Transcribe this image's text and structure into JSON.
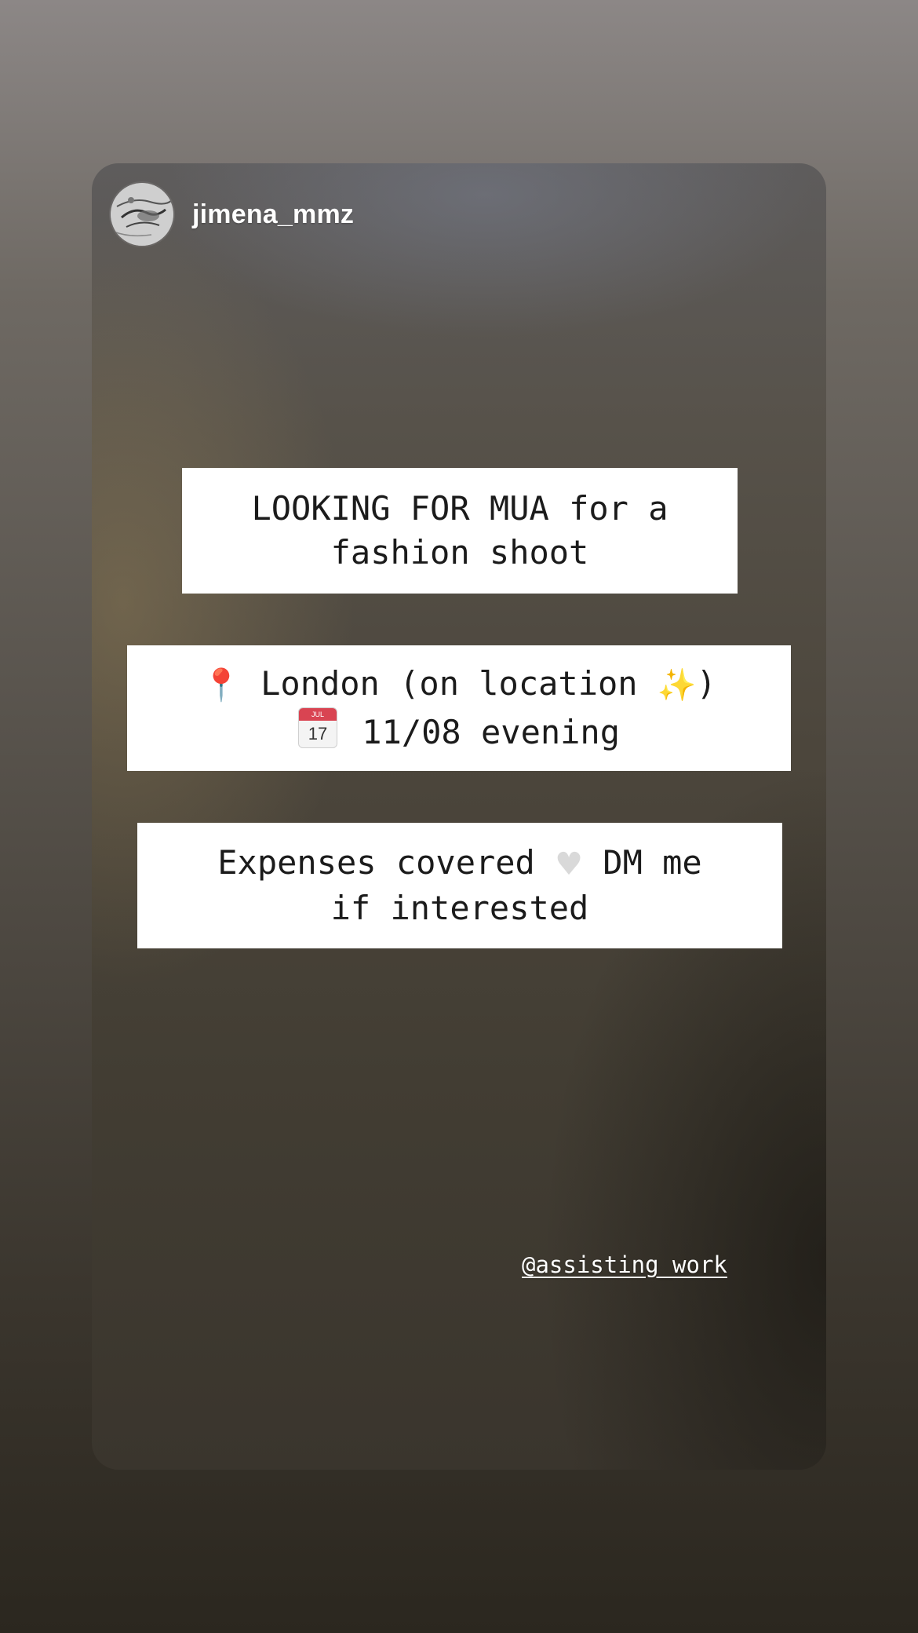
{
  "story": {
    "username": "jimena_mmz",
    "stickers": [
      {
        "lines": [
          "LOOKING FOR MUA for a",
          "fashion shoot"
        ]
      },
      {
        "line1": "London (on location ",
        "line1_end": ")",
        "line2": "11/08 evening"
      },
      {
        "line1_a": "Expenses covered ",
        "line1_b": " DM me",
        "line2": "if interested"
      }
    ],
    "calendar_icon": {
      "month": "JUL",
      "day": "17"
    },
    "mention": "@assisting_work"
  },
  "icons": {
    "avatar": "avatar-image",
    "pin": "round-pushpin-icon",
    "sparkles": "sparkles-icon",
    "calendar": "calendar-icon",
    "heart": "white-heart-icon"
  },
  "colors": {
    "sticker_background": "#ffffff",
    "sticker_text": "#1b1b1b",
    "header_text": "#ffffff"
  }
}
